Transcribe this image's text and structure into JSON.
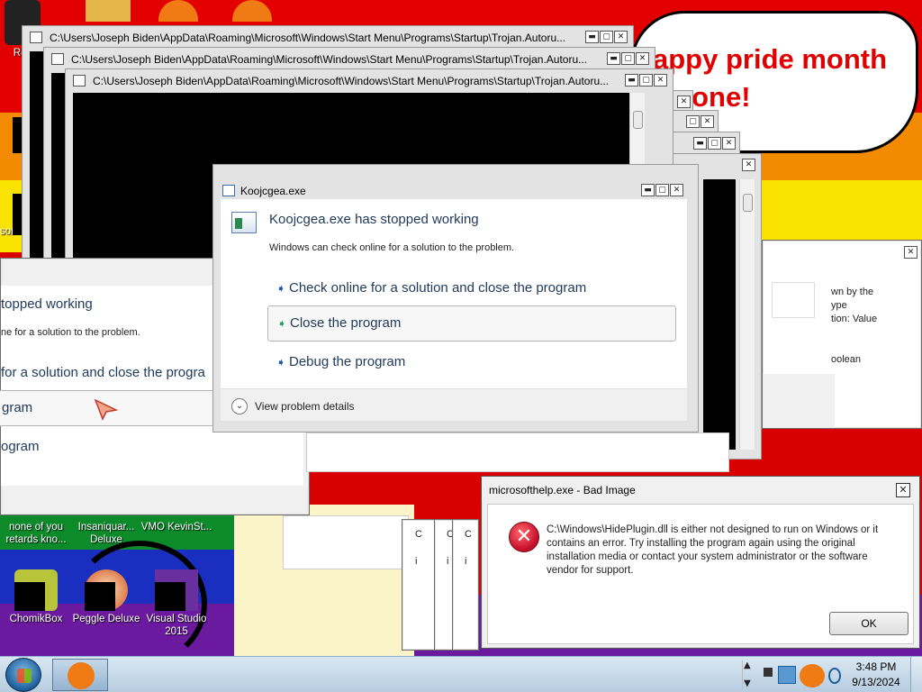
{
  "desktop": {
    "bubble_text": "appy pride month\n   yone!",
    "icons": [
      {
        "label": "none of you retards kno..."
      },
      {
        "label": "Insaniquar... Deluxe"
      },
      {
        "label": "VMO KevinSt..."
      },
      {
        "label": "ChomikBox"
      },
      {
        "label": "Peggle Deluxe"
      },
      {
        "label": "Visual Studio 2015"
      }
    ],
    "partial_labels": {
      "top_left": "Rec",
      "mid_left": "son"
    }
  },
  "console_windows": [
    {
      "title": "C:\\Users\\Joseph Biden\\AppData\\Roaming\\Microsoft\\Windows\\Start Menu\\Programs\\Startup\\Trojan.Autoru..."
    },
    {
      "title": "C:\\Users\\Joseph Biden\\AppData\\Roaming\\Microsoft\\Windows\\Start Menu\\Programs\\Startup\\Trojan.Autoru..."
    },
    {
      "title": "C:\\Users\\Joseph Biden\\AppData\\Roaming\\Microsoft\\Windows\\Start Menu\\Programs\\Startup\\Trojan.Autoru..."
    }
  ],
  "caption_buttons": {
    "minimize": "▬",
    "maximize": "▢",
    "close": "✕"
  },
  "left_dialog": {
    "heading": "topped working",
    "subtext": "ne for a solution to the problem.",
    "option1": "for a solution and close the progra",
    "option2": "gram",
    "option3": "ogram"
  },
  "right_dialog": {
    "lines": [
      "wn by the",
      "ype",
      "tion: Value",
      "oolean"
    ]
  },
  "small_windows": {
    "cols": [
      "C",
      "i"
    ]
  },
  "main_dialog": {
    "title": "Koojcgea.exe",
    "heading": "Koojcgea.exe has stopped working",
    "subtext": "Windows can check online for a solution to the problem.",
    "options": [
      {
        "label": "Check online for a solution and close the program"
      },
      {
        "label": "Close the program"
      },
      {
        "label": "Debug the program"
      }
    ],
    "details": "View problem details"
  },
  "bad_image": {
    "title": "microsofthelp.exe - Bad Image",
    "message": "C:\\Windows\\HidePlugin.dll is either not designed to run on Windows or it contains an error. Try installing the program again using the original installation media or contact your system administrator or the software vendor for support.",
    "ok": "OK",
    "close": "✕"
  },
  "taskbar": {
    "time": "3:48 PM",
    "date": "9/13/2024",
    "tray_arrow": "▲"
  },
  "colors": {
    "accent_red": "#e20000",
    "error_red": "#c8102e",
    "link_blue": "#1e395b"
  }
}
